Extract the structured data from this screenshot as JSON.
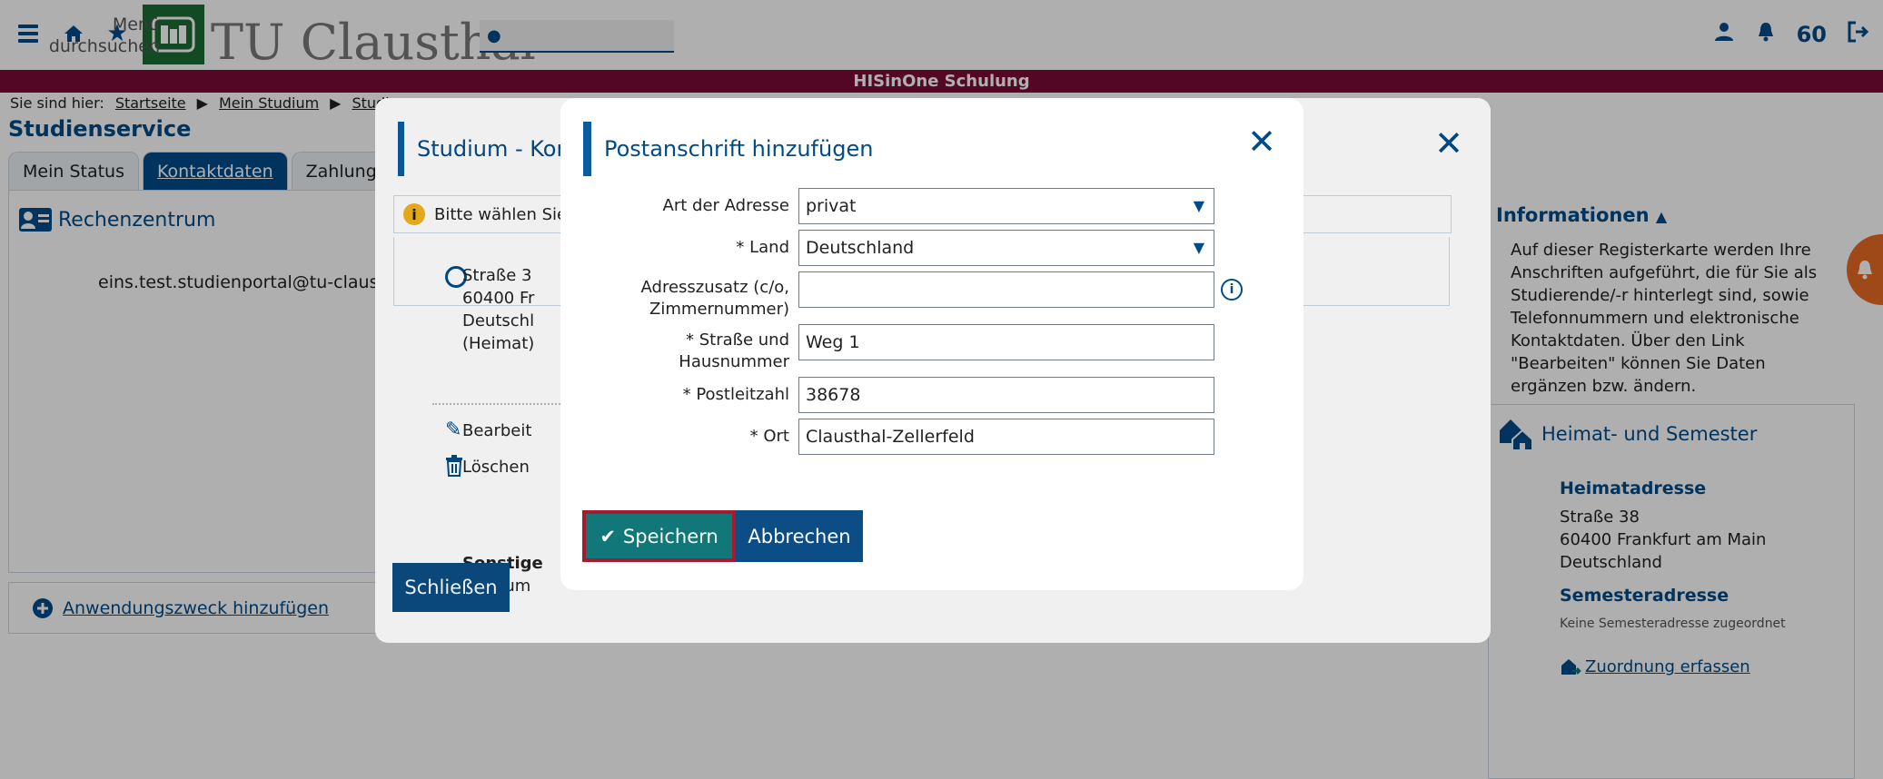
{
  "header": {
    "logo_text": "TU Clausthal",
    "search_placeholder": "Menü durchsuchen",
    "counter": "60",
    "band_text": "HISinOne Schulung"
  },
  "breadcrumb": {
    "prefix": "Sie sind hier:",
    "items": [
      "Startseite",
      "Mein Studium",
      "Studie"
    ]
  },
  "page_title": "Studienservice",
  "tabs": [
    "Mein Status",
    "Kontaktdaten",
    "Zahlungen"
  ],
  "left_panel": {
    "title": "Rechenzentrum",
    "email": "eins.test.studienportal@tu-clausth",
    "zweck_link": "Anwendungszweck hinzufügen"
  },
  "right_panel": {
    "info_title": "Informationen",
    "info_text": "Auf dieser Registerkarte werden Ihre Anschriften aufgeführt, die für Sie als Studierende/-r hinterlegt sind, sowie Telefonnummern und elektronische Kontaktdaten. Über den Link \"Bearbeiten\" können Sie Daten ergänzen bzw. ändern.",
    "hs_title": "Heimat- und Semester",
    "heimat_heading": "Heimatadresse",
    "heimat_lines": [
      "Straße 38",
      "60400 Frankfurt am Main",
      "Deutschland"
    ],
    "semester_heading": "Semesteradresse",
    "semester_none": "Keine Semesteradresse zugeordnet",
    "zuordnung_link": "Zuordnung erfassen"
  },
  "dialog_study": {
    "title": "Studium - Kor",
    "hint": "Bitte wählen Sie d",
    "address_lines": [
      "Straße 3",
      "60400 Fr",
      "Deutschl",
      "(Heimat)"
    ],
    "edit": "Bearbeit",
    "delete": "Löschen",
    "other_label": "Sonstige",
    "other_value": "Studium",
    "close_button": "Schließen"
  },
  "dialog_address": {
    "title": "Postanschrift hinzufügen",
    "fields": {
      "art_label": "Art der Adresse",
      "art_value": "privat",
      "land_label": "* Land",
      "land_value": "Deutschland",
      "zusatz_label_1": "Adresszusatz (c/o,",
      "zusatz_label_2": "Zimmernummer)",
      "zusatz_value": "",
      "strasse_label_1": "* Straße und",
      "strasse_label_2": "Hausnummer",
      "strasse_value": "Weg 1",
      "plz_label": "* Postleitzahl",
      "plz_value": "38678",
      "ort_label": "* Ort",
      "ort_value": "Clausthal-Zellerfeld"
    },
    "save_button": "Speichern",
    "cancel_button": "Abbrechen"
  }
}
